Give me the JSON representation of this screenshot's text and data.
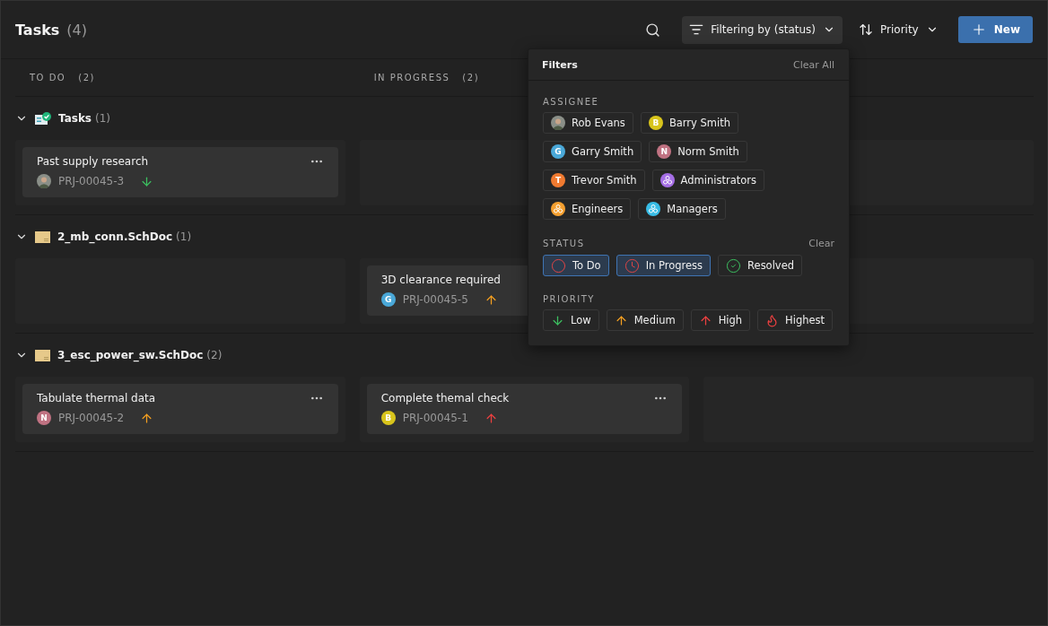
{
  "header": {
    "title": "Tasks",
    "count": "(4)"
  },
  "toolbar": {
    "filter_label": "Filtering by (status)",
    "sort_label": "Priority",
    "new_label": "New"
  },
  "columns": [
    {
      "label": "TO DO",
      "count": "(2)"
    },
    {
      "label": "IN PROGRESS",
      "count": "(2)"
    }
  ],
  "groups": [
    {
      "name": "Tasks",
      "count": "(1)",
      "kind": "tasks",
      "expanded": true,
      "lanes": [
        {
          "kind": "card",
          "title": "Past supply research",
          "id": "PRJ-00045-3",
          "avatar": {
            "kind": "photo"
          },
          "priority": {
            "kind": "low"
          }
        },
        {
          "kind": "empty"
        },
        {
          "kind": "empty"
        }
      ]
    },
    {
      "name": "2_mb_conn.SchDoc",
      "count": "(1)",
      "kind": "document",
      "expanded": true,
      "lanes": [
        {
          "kind": "empty"
        },
        {
          "kind": "card",
          "title": "3D clearance required",
          "id": "PRJ-00045-5",
          "avatar": {
            "kind": "letter",
            "letter": "G",
            "color": "#4aa8d8"
          },
          "priority": {
            "kind": "medium"
          }
        },
        {
          "kind": "empty"
        }
      ]
    },
    {
      "name": "3_esc_power_sw.SchDoc",
      "count": "(2)",
      "kind": "document",
      "expanded": true,
      "lanes": [
        {
          "kind": "card",
          "title": "Tabulate thermal data",
          "id": "PRJ-00045-2",
          "avatar": {
            "kind": "letter",
            "letter": "N",
            "color": "#c07282"
          },
          "priority": {
            "kind": "medium"
          }
        },
        {
          "kind": "card",
          "title": "Complete themal check",
          "id": "PRJ-00045-1",
          "avatar": {
            "kind": "letter",
            "letter": "B",
            "color": "#d8c41c"
          },
          "priority": {
            "kind": "high"
          }
        },
        {
          "kind": "empty"
        }
      ]
    }
  ],
  "filters": {
    "title": "Filters",
    "clear_all": "Clear All",
    "assignee": {
      "label": "ASSIGNEE",
      "chips": [
        {
          "label": "Rob Evans",
          "avatar": {
            "kind": "photo"
          }
        },
        {
          "label": "Barry Smith",
          "avatar": {
            "kind": "letter",
            "letter": "B",
            "color": "#d8c41c"
          }
        },
        {
          "label": "Garry Smith",
          "avatar": {
            "kind": "letter",
            "letter": "G",
            "color": "#4aa8d8"
          }
        },
        {
          "label": "Norm Smith",
          "avatar": {
            "kind": "letter",
            "letter": "N",
            "color": "#c07282"
          }
        },
        {
          "label": "Trevor Smith",
          "avatar": {
            "kind": "letter",
            "letter": "T",
            "color": "#f07a30"
          }
        },
        {
          "label": "Administrators",
          "avatar": {
            "kind": "group",
            "color": "#a56ee6"
          }
        },
        {
          "label": "Engineers",
          "avatar": {
            "kind": "group",
            "color": "#f5a030"
          }
        },
        {
          "label": "Managers",
          "avatar": {
            "kind": "group",
            "color": "#38bde6"
          }
        }
      ]
    },
    "status": {
      "label": "STATUS",
      "clear": "Clear",
      "chips": [
        {
          "label": "To Do",
          "kind": "todo",
          "selected": true
        },
        {
          "label": "In Progress",
          "kind": "progress",
          "selected": true
        },
        {
          "label": "Resolved",
          "kind": "resolved",
          "selected": false
        }
      ]
    },
    "priority": {
      "label": "PRIORITY",
      "chips": [
        {
          "label": "Low",
          "kind": "low"
        },
        {
          "label": "Medium",
          "kind": "medium"
        },
        {
          "label": "High",
          "kind": "high"
        },
        {
          "label": "Highest",
          "kind": "highest"
        }
      ]
    }
  }
}
